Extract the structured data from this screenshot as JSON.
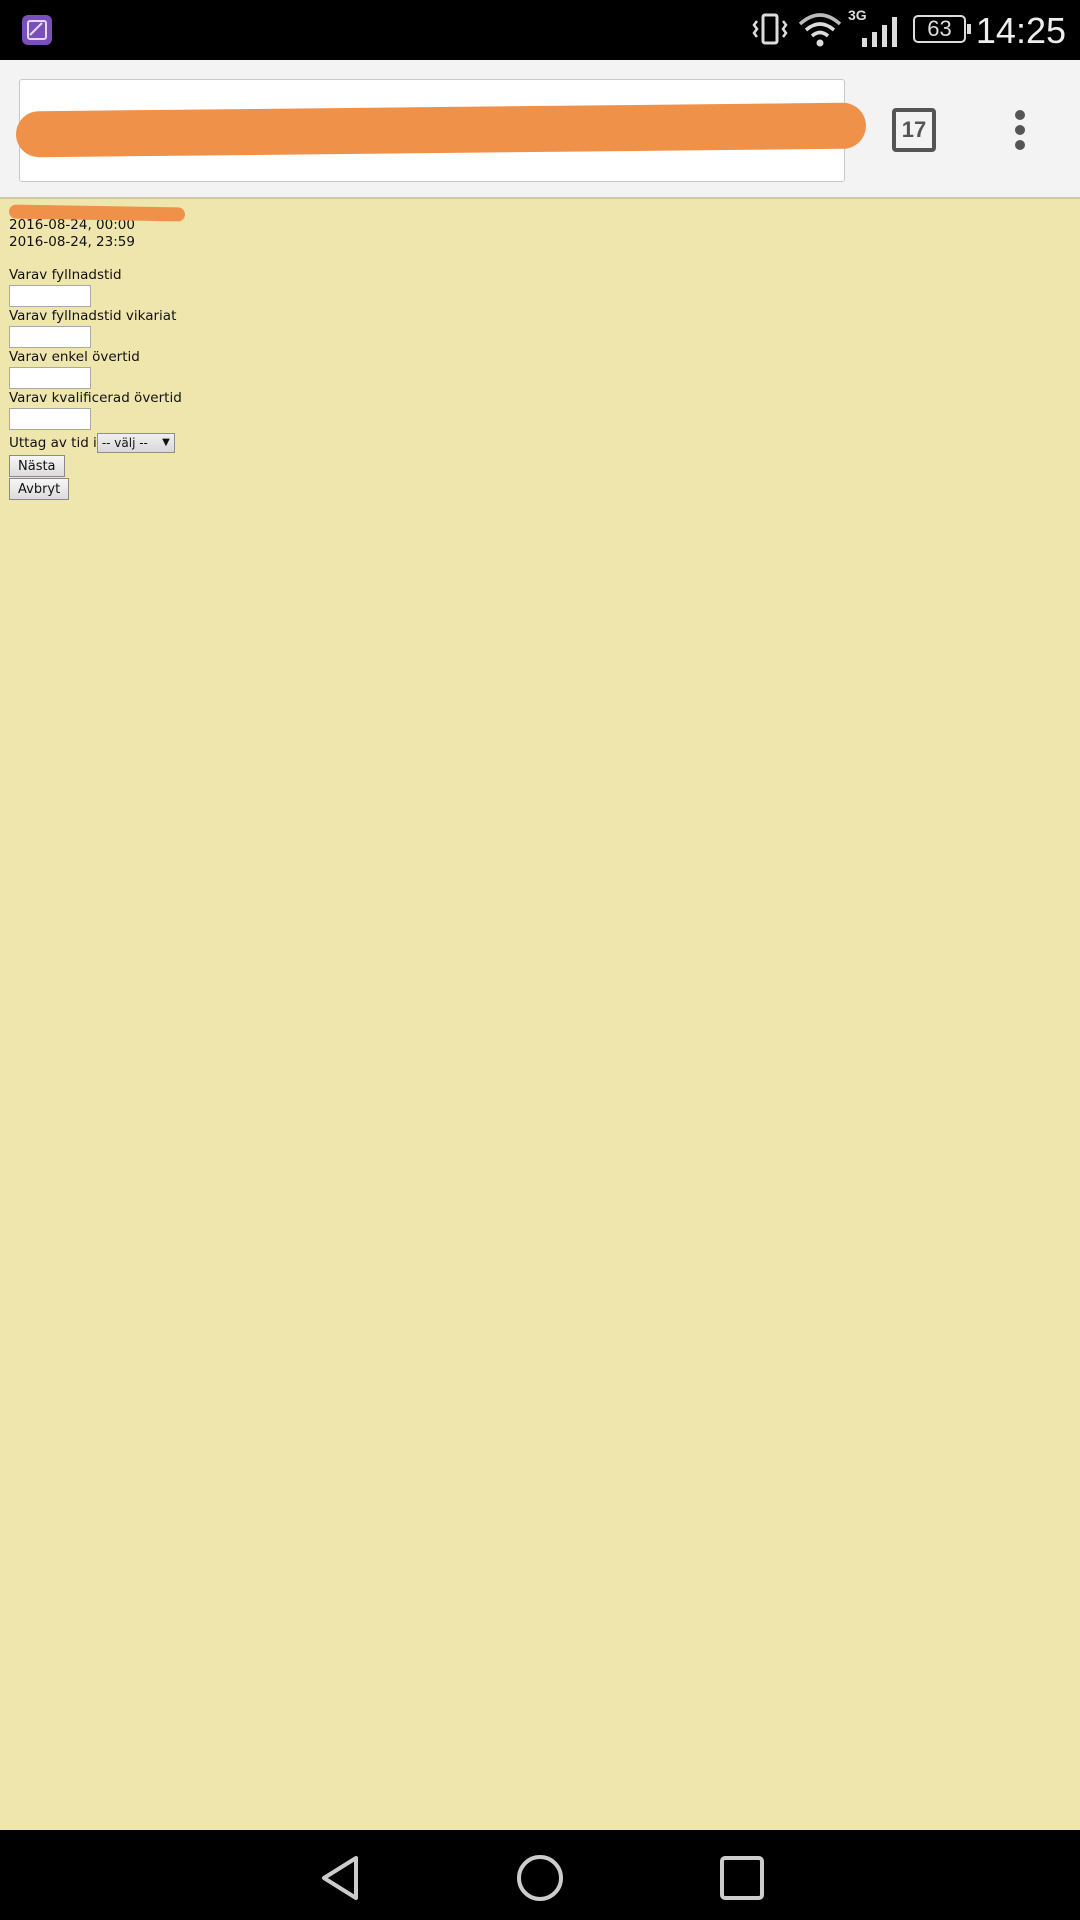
{
  "status_bar": {
    "time": "14:25",
    "battery": "63",
    "network": "3G",
    "icons": [
      "gallery-icon",
      "vibrate-icon",
      "wifi-icon",
      "signal-icon",
      "battery-icon"
    ]
  },
  "browser": {
    "url": "",
    "tab_count": "17",
    "icons": [
      "menu-dots-icon"
    ]
  },
  "page": {
    "start_time": "2016-08-24, 00:00",
    "end_time": "2016-08-24, 23:59",
    "fields": [
      {
        "label": "Varav fyllnadstid",
        "value": ""
      },
      {
        "label": "Varav fyllnadstid vikariat",
        "value": ""
      },
      {
        "label": "Varav enkel övertid",
        "value": ""
      },
      {
        "label": "Varav kvalificerad övertid",
        "value": ""
      }
    ],
    "withdrawal_label": "Uttag av tid i",
    "withdrawal_select": "-- välj --",
    "next_button": "Nästa",
    "cancel_button": "Avbryt"
  },
  "colors": {
    "page_background": "#efe6ae",
    "redaction": "#f0914a"
  },
  "nav_bar": {
    "icons": [
      "back-icon",
      "home-icon",
      "recents-icon"
    ]
  }
}
